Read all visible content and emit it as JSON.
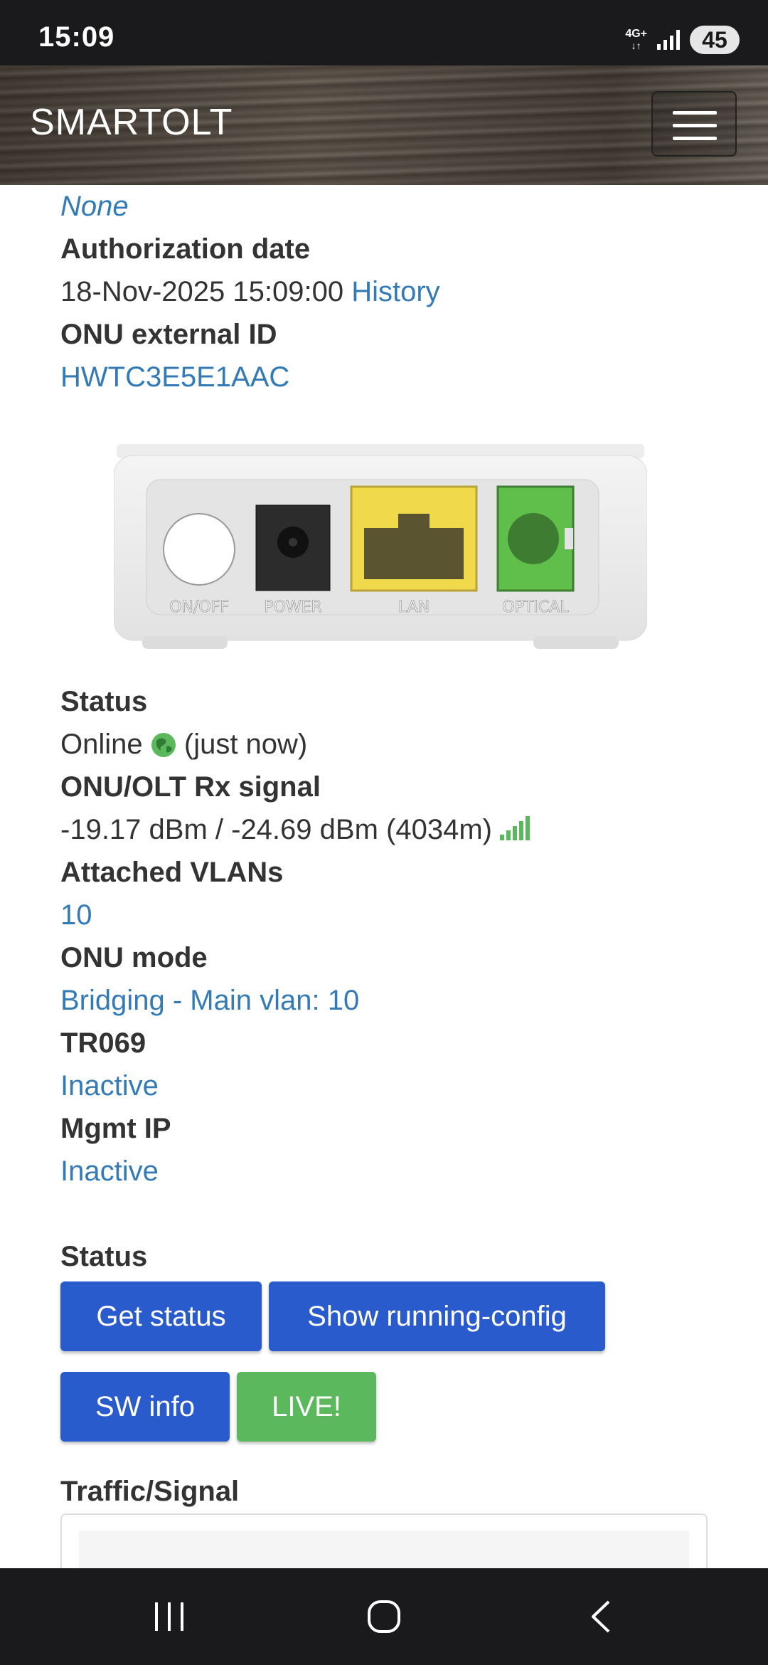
{
  "status_bar": {
    "time": "15:09",
    "network": "4G+",
    "battery": "45"
  },
  "navbar": {
    "brand": "SMARTOLT"
  },
  "details": {
    "top_value": "None",
    "authorization_date_label": "Authorization date",
    "authorization_date_value": "18-Nov-2025 15:09:00",
    "history_link": "History",
    "onu_external_id_label": "ONU external ID",
    "onu_external_id_value": "HWTC3E5E1AAC",
    "status_label": "Status",
    "status_value": "Online",
    "status_time": "(just now)",
    "rx_signal_label": "ONU/OLT Rx signal",
    "rx_signal_value": "-19.17 dBm / -24.69 dBm (4034m)",
    "vlans_label": "Attached VLANs",
    "vlans_value": "10",
    "onu_mode_label": "ONU mode",
    "onu_mode_value": "Bridging - Main vlan: 10",
    "tr069_label": "TR069",
    "tr069_value": "Inactive",
    "mgmt_ip_label": "Mgmt IP",
    "mgmt_ip_value": "Inactive"
  },
  "device_ports": [
    "ON/OFF",
    "POWER",
    "LAN",
    "OPTICAL"
  ],
  "actions": {
    "section_label": "Status",
    "get_status": "Get status",
    "show_running_config": "Show running-config",
    "sw_info": "SW info",
    "live": "LIVE!"
  },
  "traffic": {
    "label": "Traffic/Signal"
  },
  "colors": {
    "link": "#337ab7",
    "primary_button": "#2a5bcc",
    "success_button": "#5cb85c",
    "signal_green": "#5cb85c"
  }
}
